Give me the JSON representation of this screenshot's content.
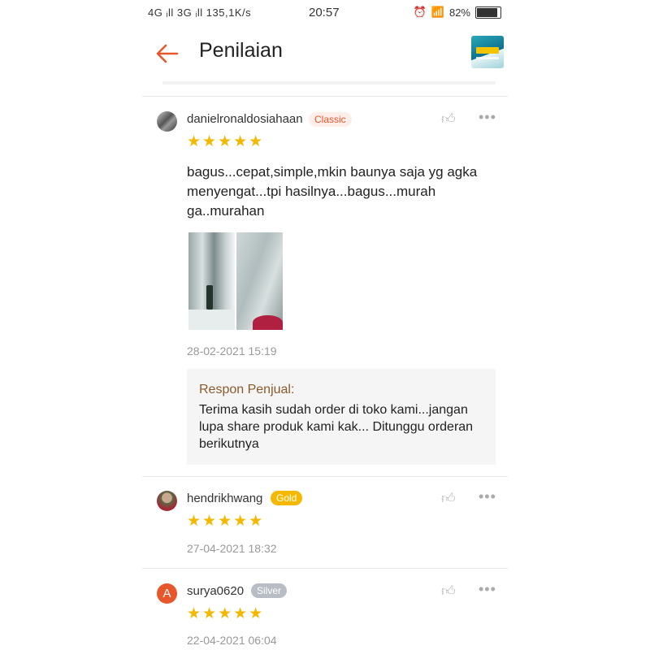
{
  "status_bar": {
    "signal": "4G ᵢll 3G ᵢll",
    "speed": "135,1K/s",
    "time": "20:57",
    "battery": "82%"
  },
  "header": {
    "title": "Penilaian"
  },
  "reviews": [
    {
      "username": "danielronaldosiahaan",
      "badge": "Classic",
      "rating": 5,
      "stars": "★★★★★",
      "text": "bagus...cepat,simple,mkin baunya saja yg agka menyengat...tpi hasilnya...bagus...murah ga..murahan",
      "date": "28-02-2021 15:19",
      "seller_label": "Respon Penjual:",
      "seller_text": "Terima kasih sudah order di toko kami...jangan lupa share produk kami kak... Ditunggu orderan berikutnya"
    },
    {
      "username": "hendrikhwang",
      "badge": "Gold",
      "rating": 5,
      "stars": "★★★★★",
      "date": "27-04-2021 18:32"
    },
    {
      "username": "surya0620",
      "avatar_letter": "A",
      "badge": "Silver",
      "rating": 5,
      "stars": "★★★★★",
      "date": "22-04-2021 06:04"
    }
  ],
  "icons": {
    "back": "back-arrow-icon",
    "like": "thumbs-up-icon",
    "more": "more-dots-icon"
  },
  "colors": {
    "accent": "#e8562b",
    "star": "#f5b800",
    "gold": "#f5b800",
    "silver": "#b8bcc4"
  }
}
